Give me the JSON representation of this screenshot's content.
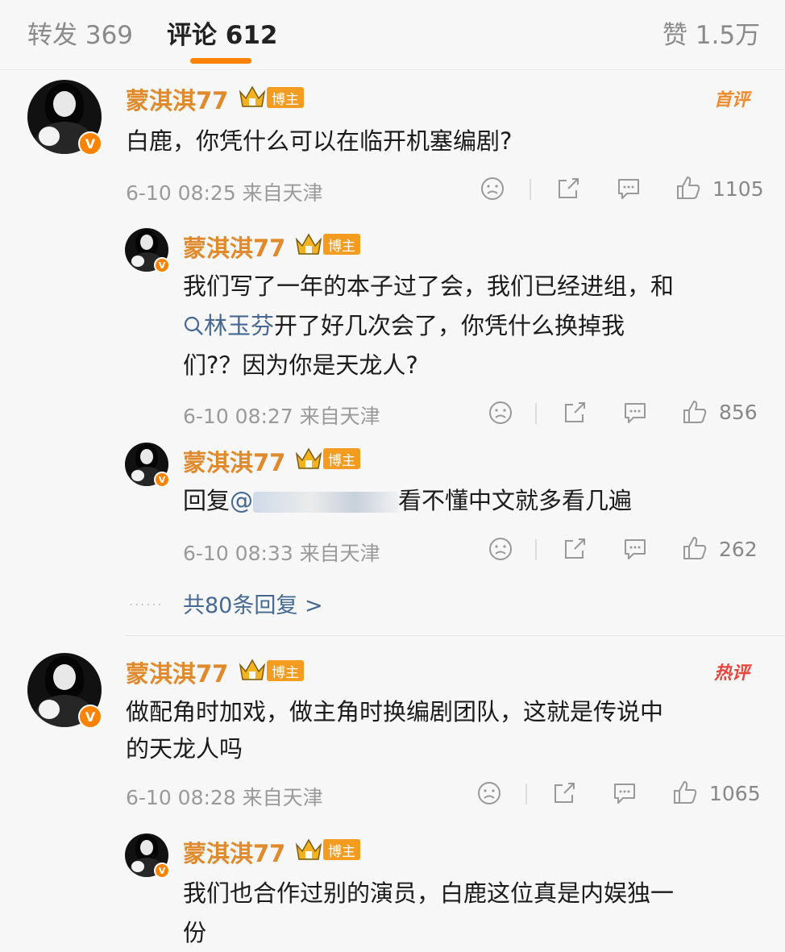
{
  "tabs": {
    "repost": "转发 369",
    "comments": "评论 612",
    "likes": "赞 1.5万"
  },
  "colors": {
    "accent": "#ff8200",
    "username": "#e08a2c",
    "link": "#466994",
    "first_tag": "#f08b2e",
    "hot_tag": "#e8453c"
  },
  "badge_text": "博主",
  "comments": [
    {
      "username": "蒙淇淇77",
      "tag": "首评",
      "text": "白鹿，你凭什么可以在临开机塞编剧?",
      "meta": "6-10 08:25 来自天津",
      "likes": "1105",
      "replies": [
        {
          "username": "蒙淇淇77",
          "line1": "我们写了一年的本子过了会，我们已经进组，和",
          "link_icon": "search-icon",
          "link": "林玉芬",
          "line2_rest": "开了好几次会了，你凭什么换掉我",
          "line3": "们?？因为你是天龙人?",
          "meta": "6-10 08:27 来自天津",
          "likes": "856"
        },
        {
          "username": "蒙淇淇77",
          "prefix": "回复",
          "mention": "@",
          "text": "看不懂中文就多看几遍",
          "meta": "6-10 08:33 来自天津",
          "likes": "262"
        }
      ],
      "more_dots": "......",
      "more_replies": "共80条回复 >"
    },
    {
      "username": "蒙淇淇77",
      "tag": "热评",
      "line1": "做配角时加戏，做主角时换编剧团队，这就是传说中",
      "line2": "的天龙人吗",
      "meta": "6-10 08:28 来自天津",
      "likes": "1065",
      "replies": [
        {
          "username": "蒙淇淇77",
          "line1": "我们也合作过别的演员，白鹿这位真是内娱独一",
          "line2": "份"
        }
      ]
    }
  ]
}
